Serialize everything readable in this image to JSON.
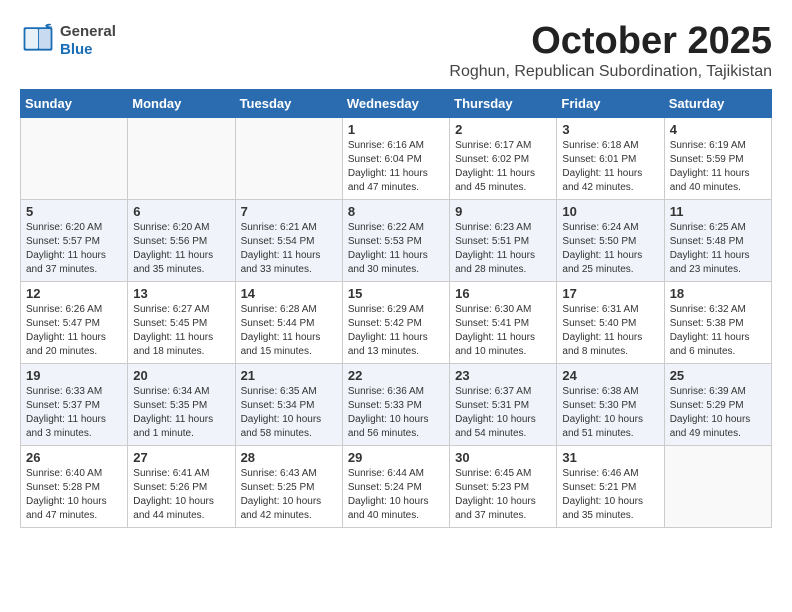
{
  "header": {
    "logo_general": "General",
    "logo_blue": "Blue",
    "month_title": "October 2025",
    "subtitle": "Roghun, Republican Subordination, Tajikistan"
  },
  "days_of_week": [
    "Sunday",
    "Monday",
    "Tuesday",
    "Wednesday",
    "Thursday",
    "Friday",
    "Saturday"
  ],
  "weeks": [
    [
      {
        "day": "",
        "info": ""
      },
      {
        "day": "",
        "info": ""
      },
      {
        "day": "",
        "info": ""
      },
      {
        "day": "1",
        "info": "Sunrise: 6:16 AM\nSunset: 6:04 PM\nDaylight: 11 hours and 47 minutes."
      },
      {
        "day": "2",
        "info": "Sunrise: 6:17 AM\nSunset: 6:02 PM\nDaylight: 11 hours and 45 minutes."
      },
      {
        "day": "3",
        "info": "Sunrise: 6:18 AM\nSunset: 6:01 PM\nDaylight: 11 hours and 42 minutes."
      },
      {
        "day": "4",
        "info": "Sunrise: 6:19 AM\nSunset: 5:59 PM\nDaylight: 11 hours and 40 minutes."
      }
    ],
    [
      {
        "day": "5",
        "info": "Sunrise: 6:20 AM\nSunset: 5:57 PM\nDaylight: 11 hours and 37 minutes."
      },
      {
        "day": "6",
        "info": "Sunrise: 6:20 AM\nSunset: 5:56 PM\nDaylight: 11 hours and 35 minutes."
      },
      {
        "day": "7",
        "info": "Sunrise: 6:21 AM\nSunset: 5:54 PM\nDaylight: 11 hours and 33 minutes."
      },
      {
        "day": "8",
        "info": "Sunrise: 6:22 AM\nSunset: 5:53 PM\nDaylight: 11 hours and 30 minutes."
      },
      {
        "day": "9",
        "info": "Sunrise: 6:23 AM\nSunset: 5:51 PM\nDaylight: 11 hours and 28 minutes."
      },
      {
        "day": "10",
        "info": "Sunrise: 6:24 AM\nSunset: 5:50 PM\nDaylight: 11 hours and 25 minutes."
      },
      {
        "day": "11",
        "info": "Sunrise: 6:25 AM\nSunset: 5:48 PM\nDaylight: 11 hours and 23 minutes."
      }
    ],
    [
      {
        "day": "12",
        "info": "Sunrise: 6:26 AM\nSunset: 5:47 PM\nDaylight: 11 hours and 20 minutes."
      },
      {
        "day": "13",
        "info": "Sunrise: 6:27 AM\nSunset: 5:45 PM\nDaylight: 11 hours and 18 minutes."
      },
      {
        "day": "14",
        "info": "Sunrise: 6:28 AM\nSunset: 5:44 PM\nDaylight: 11 hours and 15 minutes."
      },
      {
        "day": "15",
        "info": "Sunrise: 6:29 AM\nSunset: 5:42 PM\nDaylight: 11 hours and 13 minutes."
      },
      {
        "day": "16",
        "info": "Sunrise: 6:30 AM\nSunset: 5:41 PM\nDaylight: 11 hours and 10 minutes."
      },
      {
        "day": "17",
        "info": "Sunrise: 6:31 AM\nSunset: 5:40 PM\nDaylight: 11 hours and 8 minutes."
      },
      {
        "day": "18",
        "info": "Sunrise: 6:32 AM\nSunset: 5:38 PM\nDaylight: 11 hours and 6 minutes."
      }
    ],
    [
      {
        "day": "19",
        "info": "Sunrise: 6:33 AM\nSunset: 5:37 PM\nDaylight: 11 hours and 3 minutes."
      },
      {
        "day": "20",
        "info": "Sunrise: 6:34 AM\nSunset: 5:35 PM\nDaylight: 11 hours and 1 minute."
      },
      {
        "day": "21",
        "info": "Sunrise: 6:35 AM\nSunset: 5:34 PM\nDaylight: 10 hours and 58 minutes."
      },
      {
        "day": "22",
        "info": "Sunrise: 6:36 AM\nSunset: 5:33 PM\nDaylight: 10 hours and 56 minutes."
      },
      {
        "day": "23",
        "info": "Sunrise: 6:37 AM\nSunset: 5:31 PM\nDaylight: 10 hours and 54 minutes."
      },
      {
        "day": "24",
        "info": "Sunrise: 6:38 AM\nSunset: 5:30 PM\nDaylight: 10 hours and 51 minutes."
      },
      {
        "day": "25",
        "info": "Sunrise: 6:39 AM\nSunset: 5:29 PM\nDaylight: 10 hours and 49 minutes."
      }
    ],
    [
      {
        "day": "26",
        "info": "Sunrise: 6:40 AM\nSunset: 5:28 PM\nDaylight: 10 hours and 47 minutes."
      },
      {
        "day": "27",
        "info": "Sunrise: 6:41 AM\nSunset: 5:26 PM\nDaylight: 10 hours and 44 minutes."
      },
      {
        "day": "28",
        "info": "Sunrise: 6:43 AM\nSunset: 5:25 PM\nDaylight: 10 hours and 42 minutes."
      },
      {
        "day": "29",
        "info": "Sunrise: 6:44 AM\nSunset: 5:24 PM\nDaylight: 10 hours and 40 minutes."
      },
      {
        "day": "30",
        "info": "Sunrise: 6:45 AM\nSunset: 5:23 PM\nDaylight: 10 hours and 37 minutes."
      },
      {
        "day": "31",
        "info": "Sunrise: 6:46 AM\nSunset: 5:21 PM\nDaylight: 10 hours and 35 minutes."
      },
      {
        "day": "",
        "info": ""
      }
    ]
  ]
}
